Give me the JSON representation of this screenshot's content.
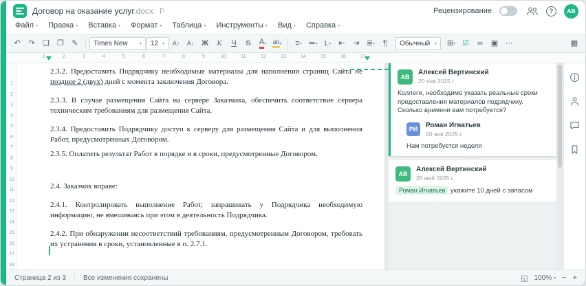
{
  "colors": {
    "accent": "#1db687",
    "avatar_green": "#3dbb7e",
    "avatar_blue": "#6a91dc",
    "mention_bg": "#dcf3e7",
    "mention_text": "#1c7a52",
    "highlight_yellow": "#f2c94c",
    "font_color_red": "#d04b3e"
  },
  "icons": {
    "flag": "⚐",
    "help": "?",
    "fit_page": "◱",
    "zoom_out": "−",
    "zoom_in": "+"
  },
  "titlebar": {
    "doc_title": "Договор на оказание услуг",
    "doc_ext": ".docx",
    "review_label": "Рецензирование",
    "avatar_initials": "АВ"
  },
  "menus": [
    "Файл",
    "Правка",
    "Вставка",
    "Формат",
    "Таблица",
    "Инструменты",
    "Вид",
    "Справка"
  ],
  "toolbar": {
    "font_name": "Times New",
    "font_size": "12",
    "style_name": "Обычный",
    "group_history": [
      {
        "name": "undo-button",
        "glyph": "↶"
      },
      {
        "name": "redo-button",
        "glyph": "↷"
      },
      {
        "name": "copy-button",
        "glyph": "❏"
      },
      {
        "name": "paste-button",
        "glyph": "❐"
      },
      {
        "name": "format-painter-button",
        "glyph": "✎"
      }
    ],
    "group_font": [
      {
        "name": "increase-font-button",
        "glyph": "А↑"
      },
      {
        "name": "decrease-font-button",
        "glyph": "А↓"
      },
      {
        "name": "bold-button",
        "glyph": "Ж"
      },
      {
        "name": "italic-button",
        "glyph": "К"
      },
      {
        "name": "underline-button",
        "glyph": "Ч"
      },
      {
        "name": "strikethrough-button",
        "glyph": "S"
      },
      {
        "name": "font-color-button",
        "glyph": "А",
        "caret": true
      },
      {
        "name": "highlight-button",
        "glyph": "ab",
        "caret": true
      }
    ],
    "group_paragraph": [
      {
        "name": "align-button",
        "glyph": "≡",
        "caret": true
      },
      {
        "name": "bullet-list-button",
        "glyph": "≔",
        "caret": true
      },
      {
        "name": "numbered-list-button",
        "glyph": "1.",
        "caret": true
      },
      {
        "name": "decrease-indent-button",
        "glyph": "⇤"
      },
      {
        "name": "increase-indent-button",
        "glyph": "⇥"
      },
      {
        "name": "line-spacing-button",
        "glyph": "≣",
        "caret": true
      },
      {
        "name": "nonprinting-chars-button",
        "glyph": "¶"
      }
    ],
    "group_insert": [
      {
        "name": "table-button",
        "glyph": "⊞",
        "caret": true
      },
      {
        "name": "checkbox-button",
        "glyph": "☑"
      },
      {
        "name": "link-button",
        "glyph": "∞"
      },
      {
        "name": "image-button",
        "glyph": "▣"
      },
      {
        "name": "more-button",
        "glyph": "⋯"
      }
    ],
    "group_tail": [
      {
        "name": "view-settings-button",
        "glyph": "▦"
      }
    ]
  },
  "ruler": {
    "h_numbers": [
      "1",
      "2",
      "3",
      "4",
      "5",
      "6",
      "7",
      "8",
      "9",
      "10",
      "11",
      "12",
      "13",
      "14",
      "15",
      "16",
      "17"
    ],
    "v_numbers": [
      "1",
      "2",
      "3",
      "4",
      "5",
      "6",
      "7",
      "8",
      "9",
      "10",
      "11",
      "12",
      "13",
      "14",
      "15",
      "16",
      "17",
      "18"
    ]
  },
  "document": {
    "p1_prefix": "2.3.2. Предоставить Подрядчику необходимые материалы для наполнения страниц Сайта не ",
    "p1_inserted": "позднее 2 (двух)",
    "p1_suffix": " дней с момента заключения Договора.",
    "p2": "2.3.3. В случае размещения Сайта на сервере Заказчика, обеспечить соответствие сервера техническим требованиям для размещения Сайта.",
    "p3": "2.3.4. Предоставить Подрядчику доступ к серверу для размещения Сайта и для выполнения Работ, предусмотренных Договором.",
    "p4": "2.3.5. Оплатить результат Работ в порядке и в сроки, предусмотренные Договором.",
    "p5": "2.4. Заказчик вправе:",
    "p6": "2.4.1. Контролировать выполнение Работ, запрашивать у Подрядчика необходимую информацию, не вмешиваясь при этом в деятельность Подрядчика.",
    "p7": "2.4.2. При обнаружении несоответствий требованиям, предусмотренным Договором, требовать их устранения в сроки, установленные в п. 2.7.1."
  },
  "comments": {
    "thread1": {
      "initials": "АВ",
      "author": "Алексей Вертинский",
      "date": "20 янв 2025 г.",
      "text": "Коллеги, необходимо указать реальные сроки предоставления материалов подрядчику. Сколько времени вам потребуется?",
      "reply": {
        "initials": "РИ",
        "author": "Роман Игнатьев",
        "date": "20 янв 2025 г.",
        "text": "Нам потребуется неделя"
      }
    },
    "thread2": {
      "initials": "АВ",
      "author": "Алексей Вертинский",
      "date": "26 май 2025 г.",
      "mention": "Роман Игнатьев",
      "text": "укажите 10 дней с запасом"
    }
  },
  "statusbar": {
    "page_label": "Страница 2 из 3",
    "saved_label": "Все изменения сохранены",
    "zoom_value": "100%"
  }
}
